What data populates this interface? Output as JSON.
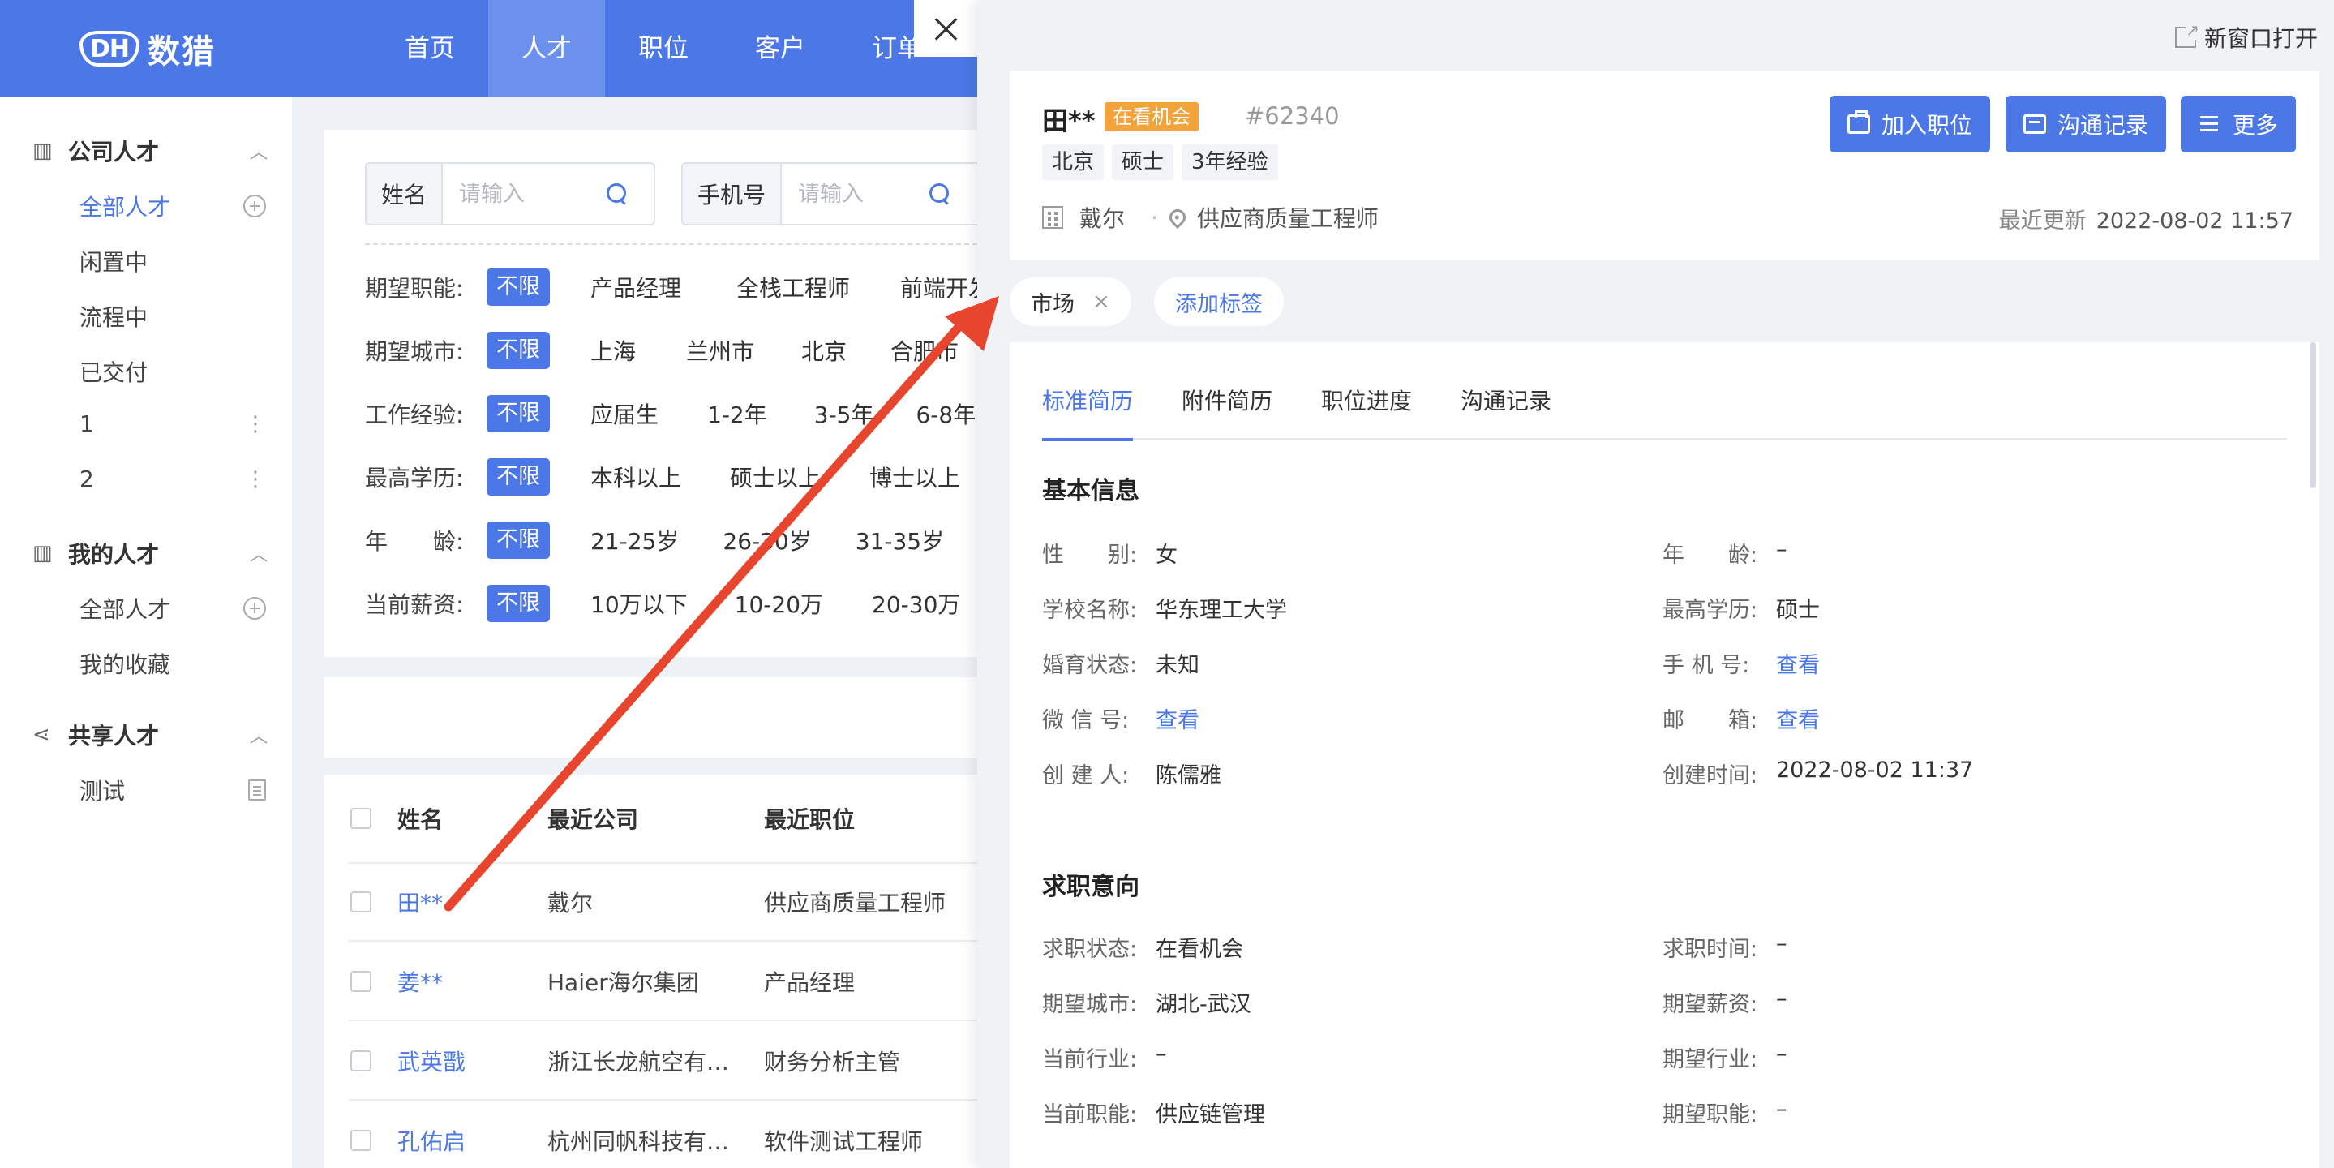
{
  "app": {
    "logo_badge": "DH",
    "logo_text": "数猎",
    "nav": [
      "首页",
      "人才",
      "职位",
      "客户",
      "订单"
    ],
    "nav_active": 1
  },
  "sidebar": {
    "company": {
      "title": "公司人才",
      "items": [
        "全部人才",
        "闲置中",
        "流程中",
        "已交付",
        "1",
        "2"
      ]
    },
    "mine": {
      "title": "我的人才",
      "items": [
        "全部人才",
        "我的收藏"
      ]
    },
    "shared": {
      "title": "共享人才",
      "items": [
        "测试"
      ]
    }
  },
  "filters": {
    "name_label": "姓名",
    "name_placeholder": "请输入",
    "phone_label": "手机号",
    "phone_placeholder": "请输入",
    "rows": [
      {
        "label": "期望职能:",
        "chip": "不限",
        "options": [
          "产品经理",
          "全栈工程师",
          "前端开发"
        ]
      },
      {
        "label": "期望城市:",
        "chip": "不限",
        "options": [
          "上海",
          "兰州市",
          "北京",
          "合肥市"
        ]
      },
      {
        "label": "工作经验:",
        "chip": "不限",
        "options": [
          "应届生",
          "1-2年",
          "3-5年",
          "6-8年"
        ]
      },
      {
        "label": "最高学历:",
        "chip": "不限",
        "options": [
          "本科以上",
          "硕士以上",
          "博士以上"
        ]
      },
      {
        "label": "年　　龄:",
        "chip": "不限",
        "options": [
          "21-25岁",
          "26-30岁",
          "31-35岁"
        ]
      },
      {
        "label": "当前薪资:",
        "chip": "不限",
        "options": [
          "10万以下",
          "10-20万",
          "20-30万"
        ]
      }
    ]
  },
  "table": {
    "headers": [
      "姓名",
      "最近公司",
      "最近职位"
    ],
    "rows": [
      {
        "name": "田**",
        "company": "戴尔",
        "position": "供应商质量工程师"
      },
      {
        "name": "姜**",
        "company": "Haier海尔集团",
        "position": "产品经理"
      },
      {
        "name": "武英戬",
        "company": "浙江长龙航空有限公司",
        "position": "财务分析主管"
      },
      {
        "name": "孔佑启",
        "company": "杭州同帆科技有限公司",
        "position": "软件测试工程师"
      }
    ]
  },
  "drawer": {
    "open_new": "新窗口打开",
    "name": "田**",
    "status_badge": "在看机会",
    "id": "#62340",
    "tags": [
      "北京",
      "硕士",
      "3年经验"
    ],
    "company": "戴尔",
    "position": "供应商质量工程师",
    "updated_label": "最近更新",
    "updated_value": "2022-08-02 11:57",
    "buttons": [
      "加入职位",
      "沟通记录",
      "更多"
    ],
    "label_tag": "市场",
    "label_tag_close": "×",
    "add_label": "添加标签",
    "tabs": [
      "标准简历",
      "附件简历",
      "职位进度",
      "沟通记录"
    ],
    "basic_title": "基本信息",
    "basic": [
      {
        "k": "性　　别:",
        "v": "女",
        "link": false
      },
      {
        "k": "年　　龄:",
        "v": "–",
        "link": false
      },
      {
        "k": "学校名称:",
        "v": "华东理工大学",
        "link": false
      },
      {
        "k": "最高学历:",
        "v": "硕士",
        "link": false
      },
      {
        "k": "婚育状态:",
        "v": "未知",
        "link": false
      },
      {
        "k": "手 机 号:",
        "v": "查看",
        "link": true
      },
      {
        "k": "微 信 号:",
        "v": "查看",
        "link": true
      },
      {
        "k": "邮　　箱:",
        "v": "查看",
        "link": true
      },
      {
        "k": "创 建 人:",
        "v": "陈儒雅",
        "link": false
      },
      {
        "k": "创建时间:",
        "v": "2022-08-02 11:37",
        "link": false
      }
    ],
    "intent_title": "求职意向",
    "intent": [
      {
        "k": "求职状态:",
        "v": "在看机会"
      },
      {
        "k": "求职时间:",
        "v": "–"
      },
      {
        "k": "期望城市:",
        "v": "湖北-武汉"
      },
      {
        "k": "期望薪资:",
        "v": "–"
      },
      {
        "k": "当前行业:",
        "v": "–"
      },
      {
        "k": "期望行业:",
        "v": "–"
      },
      {
        "k": "当前职能:",
        "v": "供应链管理"
      },
      {
        "k": "期望职能:",
        "v": "–"
      }
    ]
  },
  "colors": {
    "primary": "#4b78e6",
    "badge": "#f3a33b",
    "arrow": "#e8452f"
  }
}
